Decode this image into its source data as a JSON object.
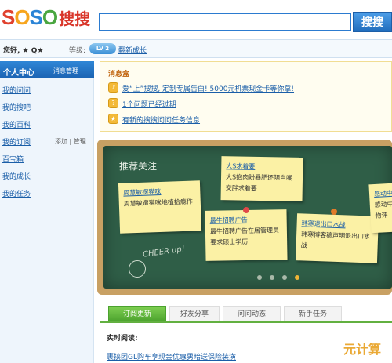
{
  "header": {
    "logo_text": "SOSO",
    "logo_cn": "搜搜",
    "search_button": "搜搜"
  },
  "userbar": {
    "greeting": "您好, ★ Q★",
    "level_label": "等级:",
    "level_badge": "LV 2",
    "growth_link": "翻新成长"
  },
  "sidebar": {
    "title": "个人中心",
    "manage_link": "消息管理",
    "items": [
      {
        "label": "我的问问"
      },
      {
        "label": "我的搜吧"
      },
      {
        "label": "我的百科"
      },
      {
        "label": "我的订阅",
        "aux": "添加 | 管理"
      },
      {
        "label": "百宝箱"
      },
      {
        "label": "我的成长"
      },
      {
        "label": "我的任务"
      }
    ]
  },
  "notice": {
    "title": "消息盒",
    "items": [
      {
        "icon": "megaphone-icon",
        "text": "爱“上”搜搜, 定制专属告白! 5000元机票现金卡等你拿!"
      },
      {
        "icon": "question-icon",
        "text": "1个问题已经过期"
      },
      {
        "icon": "gift-icon",
        "text": "有新的搜搜问问任务信息"
      }
    ]
  },
  "board": {
    "title": "推荐关注",
    "notes": [
      {
        "title": "周慧敏摆猫咪",
        "body": "周慧敏遭猫咪地植拾瘾作",
        "color": "#fbf1a5"
      },
      {
        "title": "大S求着要",
        "body": "大S抱肉盼暴肥还阴自嘲交胖求着要",
        "color": "#fbf1a5"
      },
      {
        "title": "最牛招聘广告",
        "body": "最牛招聘广告在居管理员要求硕士学历",
        "color": "#fbf1a5"
      },
      {
        "title": "韩寒退出口水战",
        "body": "韩寒博客稿声明退出口水战",
        "color": "#fbf1a5"
      },
      {
        "title": "感动中",
        "body": "感动中 人物评",
        "color": "#fbf1a5"
      }
    ],
    "chalk_text": "CHEER up!"
  },
  "tabs": [
    {
      "label": "订阅更新",
      "active": true
    },
    {
      "label": "好友分享",
      "active": false
    },
    {
      "label": "问问动态",
      "active": false
    },
    {
      "label": "新手任务",
      "active": false
    }
  ],
  "realtime": {
    "label": "实时阅读:",
    "link": "裹挟团GL购车享现金优惠男暗送保险装潢"
  },
  "watermark": "元计算",
  "colors": {
    "accent_blue": "#2b7bd0",
    "tab_green": "#4ba22e",
    "board_green": "#2f5e47",
    "frame_wood": "#c8a063"
  }
}
